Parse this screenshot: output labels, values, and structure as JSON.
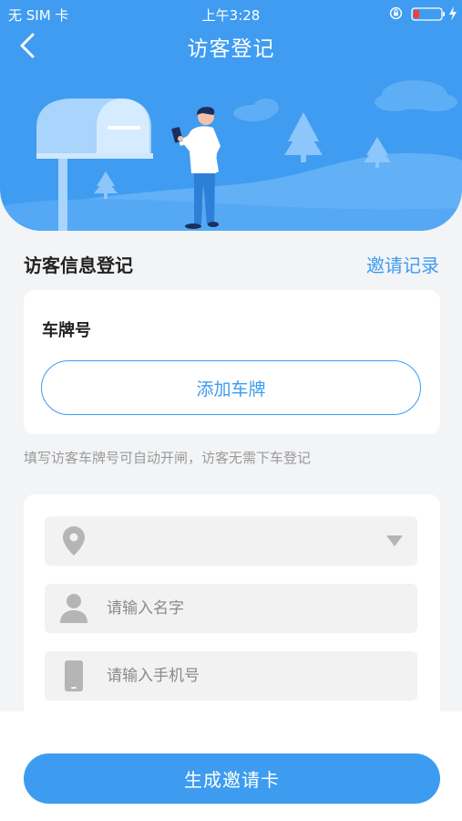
{
  "status_bar": {
    "carrier": "无 SIM 卡",
    "time": "上午3:28",
    "battery_color": "#ff3b30"
  },
  "header": {
    "title": "访客登记",
    "background_color": "#3f9cf1"
  },
  "visitor_section": {
    "title": "访客信息登记",
    "invite_record_link": "邀请记录"
  },
  "plate_card": {
    "label": "车牌号",
    "add_plate_button": "添加车牌"
  },
  "hint": "填写访客车牌号可自动开闸，访客无需下车登记",
  "form": {
    "location": {
      "icon": "location-pin-icon",
      "value": ""
    },
    "name": {
      "icon": "person-icon",
      "placeholder": "请输入名字",
      "value": ""
    },
    "phone": {
      "icon": "phone-icon",
      "placeholder": "请输入手机号",
      "value": ""
    }
  },
  "footer": {
    "generate_button": "生成邀请卡"
  },
  "colors": {
    "accent": "#3d9cf0",
    "page_background": "#f3f4f6"
  }
}
